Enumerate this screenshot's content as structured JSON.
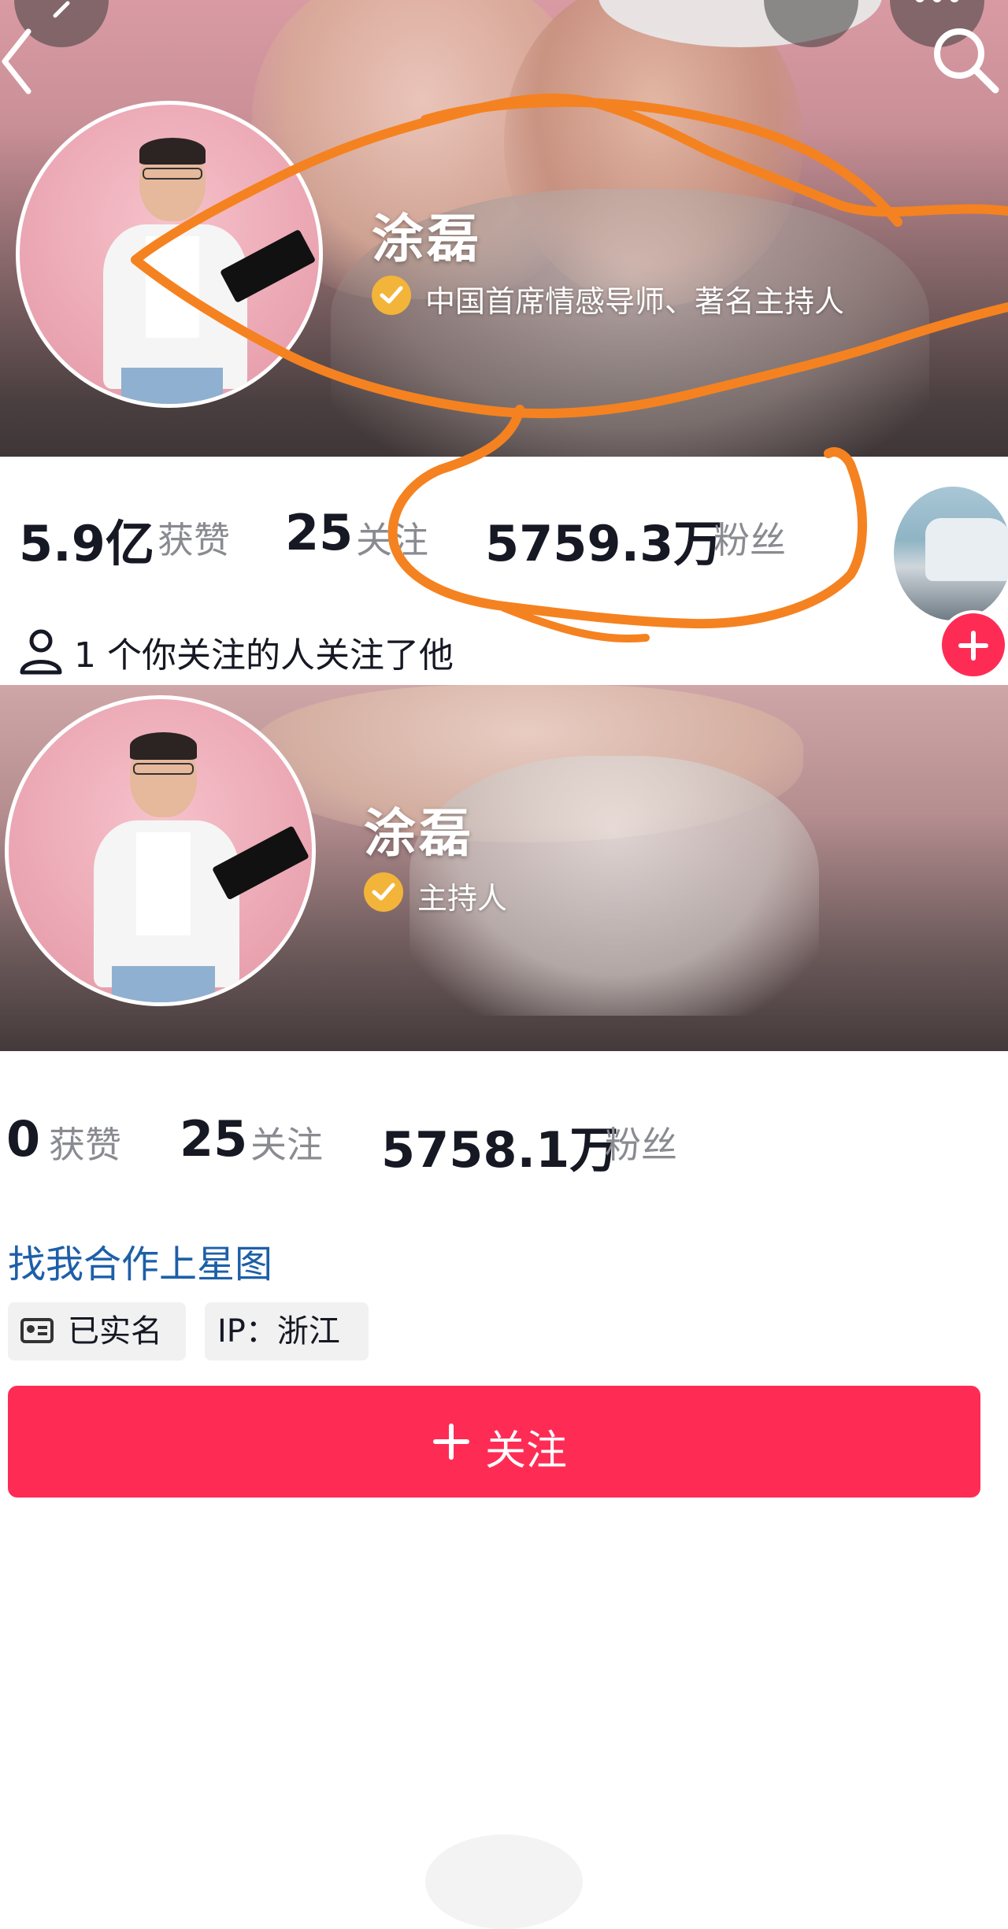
{
  "top_profile": {
    "name": "涂磊",
    "verification": "中国首席情感导师、著名主持人",
    "stats": [
      {
        "value": "5.9亿",
        "label": "获赞"
      },
      {
        "value": "25",
        "label": "关注"
      },
      {
        "value": "5759.3万",
        "label": "粉丝"
      }
    ],
    "mutual_follow": "1 个你关注的人关注了他"
  },
  "second_profile": {
    "name": "涂磊",
    "verification": "主持人",
    "stats": [
      {
        "value": "0",
        "label": "获赞"
      },
      {
        "value": "25",
        "label": "关注"
      },
      {
        "value": "5758.1万",
        "label": "粉丝"
      }
    ],
    "star_map_link": "找我合作上星图",
    "tags": [
      "已实名",
      "IP：浙江"
    ],
    "follow_button": "关注"
  },
  "colors": {
    "accent": "#fe2c55",
    "verify_badge": "#f3b43a",
    "link": "#1d5fa8",
    "annotation": "#f58220"
  },
  "icons": [
    "back-icon",
    "search-icon",
    "more-icon",
    "verified-icon",
    "person-icon",
    "id-card-icon",
    "plus-icon"
  ]
}
